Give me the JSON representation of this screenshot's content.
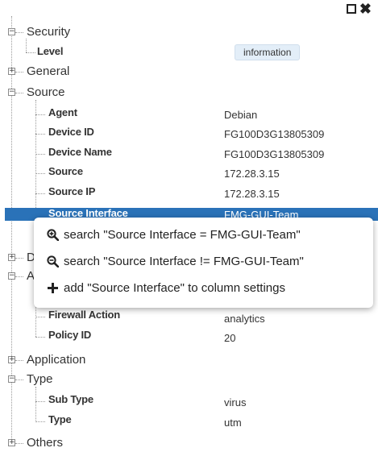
{
  "window": {
    "icons": [
      "maximize-icon",
      "close-icon"
    ]
  },
  "tree": {
    "security": {
      "label": "Security",
      "fields": [
        {
          "key": "Level",
          "value": "information"
        }
      ]
    },
    "general": {
      "label": "General"
    },
    "source": {
      "label": "Source",
      "fields": [
        {
          "key": "Agent",
          "value": "Debian"
        },
        {
          "key": "Device ID",
          "value": "FG100D3G13805309"
        },
        {
          "key": "Device Name",
          "value": "FG100D3G13805309"
        },
        {
          "key": "Source",
          "value": "172.28.3.15"
        },
        {
          "key": "Source IP",
          "value": "172.28.3.15"
        },
        {
          "key": "Source Interface",
          "value": "FMG-GUI-Team"
        }
      ]
    },
    "hidden_d": {
      "label": "D"
    },
    "hidden_a": {
      "label": "A",
      "fields": [
        {
          "key": "Firewall Action",
          "value": "analytics"
        },
        {
          "key": "Policy ID",
          "value": "20"
        }
      ]
    },
    "application": {
      "label": "Application"
    },
    "type": {
      "label": "Type",
      "fields": [
        {
          "key": "Sub Type",
          "value": "virus"
        },
        {
          "key": "Type",
          "value": "utm"
        }
      ]
    },
    "others": {
      "label": "Others"
    }
  },
  "context_menu": {
    "items": [
      {
        "icon": "zoom-in-icon",
        "label": "search \"Source Interface = FMG-GUI-Team\""
      },
      {
        "icon": "zoom-out-icon",
        "label": "search \"Source Interface != FMG-GUI-Team\""
      },
      {
        "icon": "plus-icon",
        "label": "add \"Source Interface\" to column settings"
      }
    ]
  }
}
